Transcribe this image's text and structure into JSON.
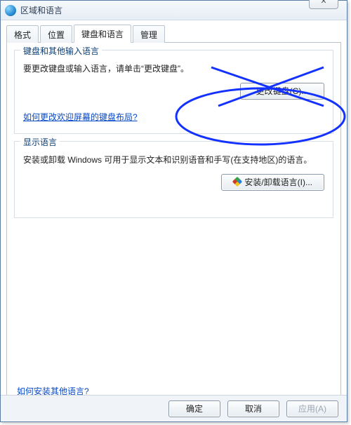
{
  "window": {
    "title": "区域和语言",
    "close_glyph": "✕"
  },
  "tabs": {
    "format": "格式",
    "location": "位置",
    "keyboard": "键盘和语言",
    "admin": "管理"
  },
  "keyboard_group": {
    "title": "键盘和其他输入语言",
    "desc": "要更改键盘或输入语言，请单击“更改键盘”。",
    "change_btn": "更改键盘(C)...",
    "link": "如何更改欢迎屏幕的键盘布局?"
  },
  "display_group": {
    "title": "显示语言",
    "desc": "安装或卸载 Windows 可用于显示文本和识别语音和手写(在支持地区)的语言。",
    "install_btn": "安装/卸载语言(I)..."
  },
  "bottom_link": "如何安装其他语言?",
  "buttons": {
    "ok": "确定",
    "cancel": "取消",
    "apply": "应用(A)"
  }
}
